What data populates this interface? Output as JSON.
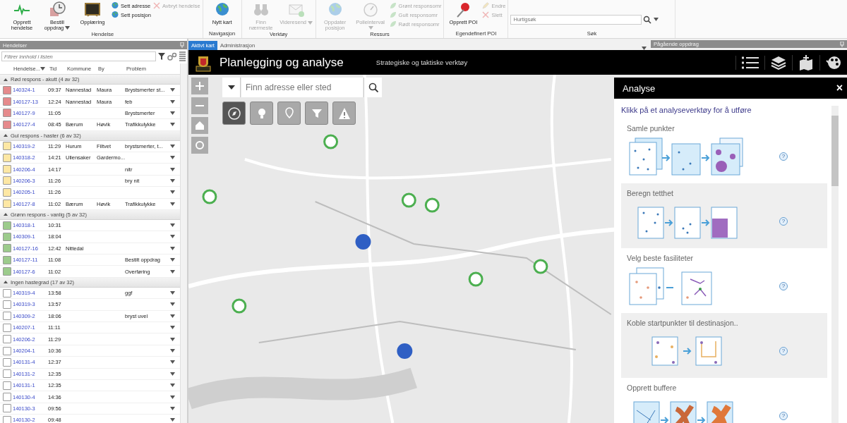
{
  "ribbon": {
    "groups": [
      {
        "kind": "buttons",
        "label": "Hendelse",
        "items": [
          {
            "kind": "large",
            "label": "Opprett hendelse",
            "disabled": false,
            "dropdown": false
          },
          {
            "kind": "large",
            "label": "Bestill oppdrag",
            "disabled": false,
            "dropdown": true
          },
          {
            "kind": "large",
            "label": "Opplæring",
            "disabled": false,
            "dropdown": false
          },
          {
            "kind": "stack",
            "items": [
              {
                "label": "Sett adresse",
                "disabled": false
              },
              {
                "label": "Sett posisjon",
                "disabled": false
              }
            ]
          },
          {
            "kind": "stack",
            "items": [
              {
                "label": "Avbryt hendelse",
                "disabled": true
              }
            ]
          }
        ]
      },
      {
        "kind": "buttons",
        "label": "Navigasjon",
        "items": [
          {
            "kind": "large",
            "label": "Nytt kart",
            "disabled": false,
            "dropdown": false
          }
        ]
      },
      {
        "kind": "buttons",
        "label": "Verktøy",
        "items": [
          {
            "kind": "large",
            "label": "Finn nærmeste",
            "disabled": true,
            "dropdown": false
          },
          {
            "kind": "large",
            "label": "Videresend",
            "disabled": true,
            "dropdown": true
          }
        ]
      },
      {
        "kind": "buttons",
        "label": "Ressurs",
        "items": [
          {
            "kind": "large",
            "label": "Oppdater posisjon",
            "disabled": true,
            "dropdown": false
          },
          {
            "kind": "large",
            "label": "Polleinterval",
            "disabled": true,
            "dropdown": true
          },
          {
            "kind": "stack",
            "items": [
              {
                "label": "Grønt responsomr",
                "disabled": true
              },
              {
                "label": "Gult responsomr",
                "disabled": true
              },
              {
                "label": "Rødt responsomr",
                "disabled": true
              }
            ]
          }
        ]
      },
      {
        "kind": "buttons",
        "label": "Egendefinert POI",
        "items": [
          {
            "kind": "large",
            "label": "Opprett POI",
            "disabled": false,
            "dropdown": false
          },
          {
            "kind": "stack",
            "items": [
              {
                "label": "Endre",
                "disabled": true
              },
              {
                "label": "Slett",
                "disabled": true
              }
            ]
          }
        ]
      },
      {
        "kind": "search",
        "label": "Søk",
        "placeholder": "Hurtigsøk"
      }
    ]
  },
  "incidents": {
    "title": "Hendelser",
    "filter_placeholder": "Filtrer innhold i listen",
    "columns": [
      "Hendelse...",
      "Tid",
      "Kommune",
      "By",
      "Problem"
    ],
    "groups": [
      {
        "title": "Rød respons - akutt (4 av 32)",
        "expanded": true,
        "rows": [
          {
            "id": "140324-1",
            "time": "09:37",
            "kommune": "Nannestad",
            "by": "Maura",
            "problem": "Brystsmerter st...",
            "color": "#e58a8c"
          },
          {
            "id": "140127-13",
            "time": "12:24",
            "kommune": "Nannestad",
            "by": "Maura",
            "problem": "feb",
            "color": "#e58a8c"
          },
          {
            "id": "140127-9",
            "time": "11:05",
            "kommune": "",
            "by": "",
            "problem": "Brystsmerter",
            "color": "#e58a8c"
          },
          {
            "id": "140127-4",
            "time": "08:45",
            "kommune": "Bærum",
            "by": "Høvik",
            "problem": "Trafikkulykke",
            "color": "#e58a8c"
          }
        ]
      },
      {
        "title": "Gul respons - haster (6 av 32)",
        "expanded": true,
        "rows": [
          {
            "id": "140319-2",
            "time": "11:29",
            "kommune": "Hurum",
            "by": "Filtvet",
            "problem": "brystsmerter, t...",
            "color": "#fde7a4"
          },
          {
            "id": "140318-2",
            "time": "14:21",
            "kommune": "Ullensaker",
            "by": "Gardermo...",
            "problem": "",
            "color": "#fde7a4"
          },
          {
            "id": "140206-4",
            "time": "14:17",
            "kommune": "",
            "by": "",
            "problem": "nitr",
            "color": "#fde7a4"
          },
          {
            "id": "140206-3",
            "time": "11:26",
            "kommune": "",
            "by": "",
            "problem": "bry nit",
            "color": "#fde7a4"
          },
          {
            "id": "140205-1",
            "time": "11:26",
            "kommune": "",
            "by": "",
            "problem": "",
            "color": "#fde7a4"
          },
          {
            "id": "140127-8",
            "time": "11:02",
            "kommune": "Bærum",
            "by": "Høvik",
            "problem": "Trafikkulykke",
            "color": "#fde7a4"
          }
        ]
      },
      {
        "title": "Grønn respons - vanlig (5 av 32)",
        "expanded": true,
        "rows": [
          {
            "id": "140318-1",
            "time": "10:31",
            "kommune": "",
            "by": "",
            "problem": "",
            "color": "#9ccb8c"
          },
          {
            "id": "140309-1",
            "time": "18:04",
            "kommune": "",
            "by": "",
            "problem": "",
            "color": "#9ccb8c"
          },
          {
            "id": "140127-16",
            "time": "12:42",
            "kommune": "Nittedal",
            "by": "",
            "problem": "",
            "color": "#9ccb8c"
          },
          {
            "id": "140127-11",
            "time": "11:08",
            "kommune": "",
            "by": "",
            "problem": "Bestilt oppdrag",
            "color": "#9ccb8c"
          },
          {
            "id": "140127-6",
            "time": "11:02",
            "kommune": "",
            "by": "",
            "problem": "Overføring",
            "color": "#9ccb8c"
          }
        ]
      },
      {
        "title": "Ingen hastegrad (17 av 32)",
        "expanded": true,
        "rows": [
          {
            "id": "140319-4",
            "time": "13:58",
            "kommune": "",
            "by": "",
            "problem": "ggf",
            "color": "#ffffff"
          },
          {
            "id": "140319-3",
            "time": "13:57",
            "kommune": "",
            "by": "",
            "problem": "",
            "color": "#ffffff"
          },
          {
            "id": "140309-2",
            "time": "18:06",
            "kommune": "",
            "by": "",
            "problem": "bryst uvel",
            "color": "#ffffff"
          },
          {
            "id": "140207-1",
            "time": "11:11",
            "kommune": "",
            "by": "",
            "problem": "",
            "color": "#ffffff"
          },
          {
            "id": "140206-2",
            "time": "11:29",
            "kommune": "",
            "by": "",
            "problem": "",
            "color": "#ffffff"
          },
          {
            "id": "140204-1",
            "time": "10:36",
            "kommune": "",
            "by": "",
            "problem": "",
            "color": "#ffffff"
          },
          {
            "id": "140131-4",
            "time": "12:37",
            "kommune": "",
            "by": "",
            "problem": "",
            "color": "#ffffff"
          },
          {
            "id": "140131-2",
            "time": "12:35",
            "kommune": "",
            "by": "",
            "problem": "",
            "color": "#ffffff"
          },
          {
            "id": "140131-1",
            "time": "12:35",
            "kommune": "",
            "by": "",
            "problem": "",
            "color": "#ffffff"
          },
          {
            "id": "140130-4",
            "time": "14:36",
            "kommune": "",
            "by": "",
            "problem": "",
            "color": "#ffffff"
          },
          {
            "id": "140130-3",
            "time": "09:56",
            "kommune": "",
            "by": "",
            "problem": "",
            "color": "#ffffff"
          },
          {
            "id": "140130-2",
            "time": "09:48",
            "kommune": "",
            "by": "",
            "problem": "",
            "color": "#ffffff"
          }
        ]
      }
    ]
  },
  "map_tabs": [
    {
      "label": "Aktivt kart",
      "selected": true
    },
    {
      "label": "Administrasjon",
      "selected": false
    }
  ],
  "side_panel": {
    "title": "Pågående oppdrag"
  },
  "app_header": {
    "title": "Planlegging og analyse",
    "subtitle": "Strategiske og taktiske verktøy"
  },
  "map": {
    "search_placeholder": "Finn adresse eller sted",
    "tools": [
      {
        "selected": true
      },
      {
        "selected": false
      },
      {
        "selected": false
      },
      {
        "selected": false
      },
      {
        "selected": false
      }
    ]
  },
  "analysis": {
    "title": "Analyse",
    "close": "×",
    "intro": "Klikk på et analyseverktøy for å utføre",
    "tools": [
      {
        "label": "Samle punkter",
        "help": "?"
      },
      {
        "label": "Beregn tetthet",
        "help": "?"
      },
      {
        "label": "Velg beste fasiliteter",
        "help": "?"
      },
      {
        "label": "Koble startpunkter til destinasjon..",
        "help": "?"
      },
      {
        "label": "Opprett buffere",
        "help": "?"
      }
    ]
  }
}
